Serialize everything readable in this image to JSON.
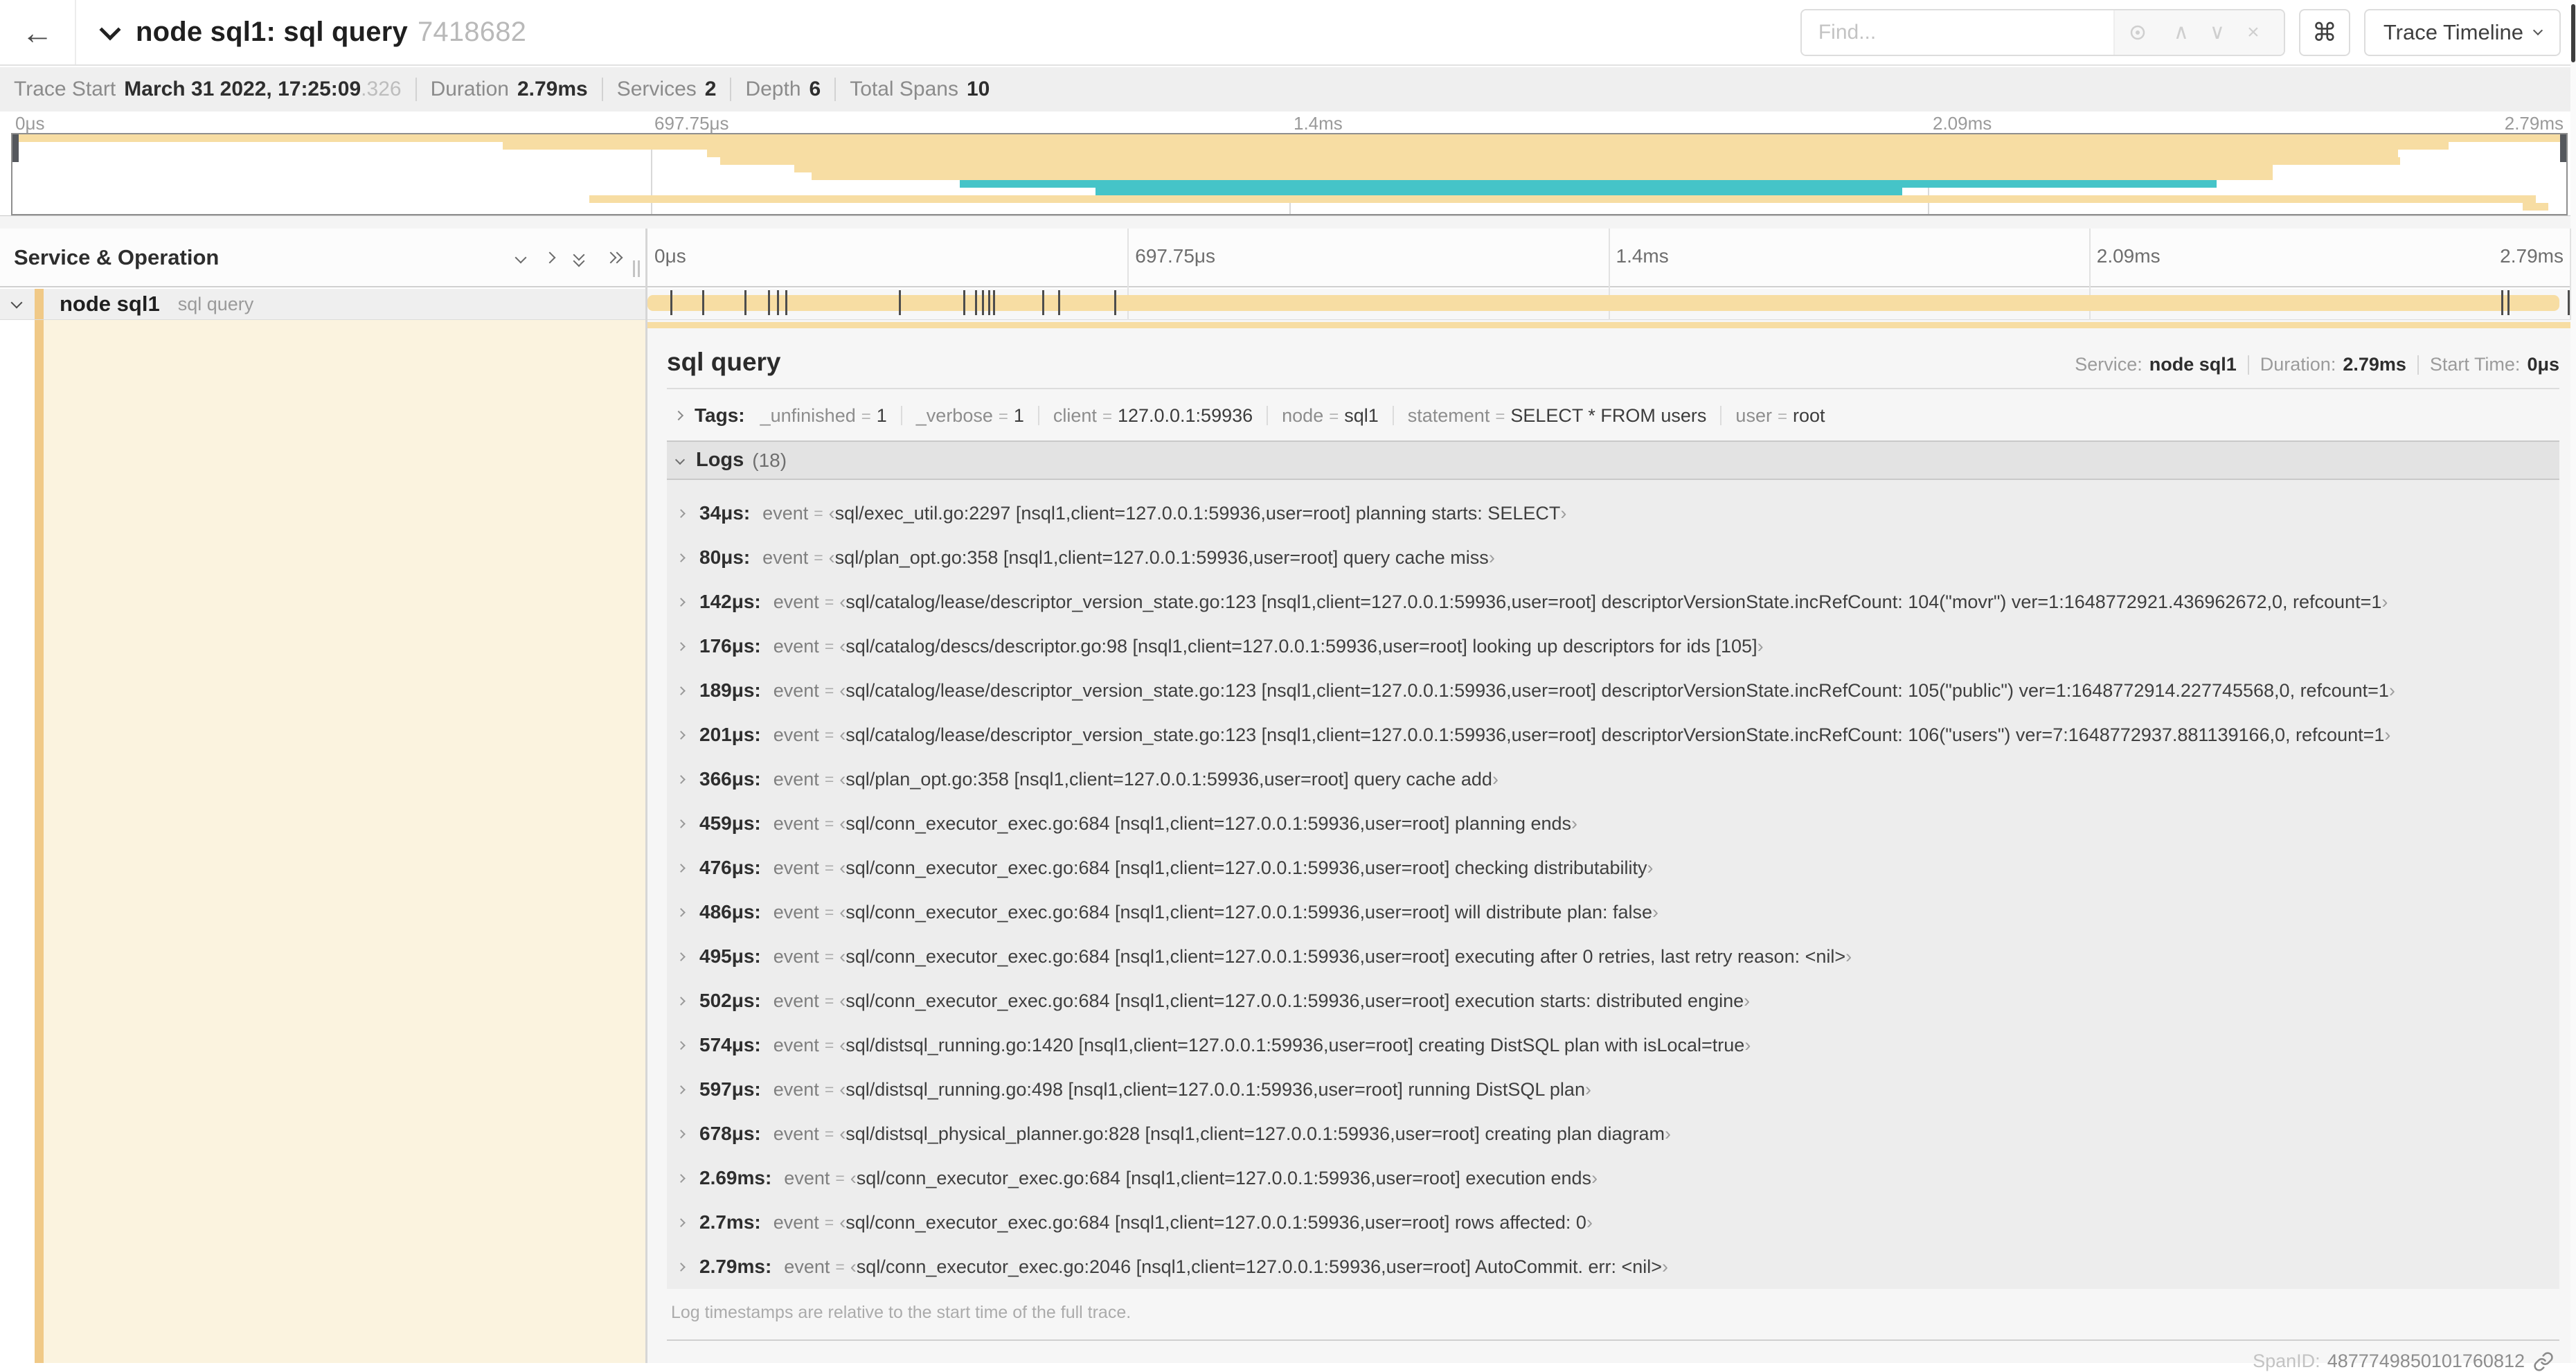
{
  "header": {
    "back_icon": "←",
    "title": "node sql1: sql query",
    "trace_id": "7418682",
    "find_placeholder": "Find...",
    "up_icon": "∧",
    "down_icon": "∨",
    "clear_icon": "×",
    "shortcut_icon": "⌘",
    "view_selector": "Trace Timeline"
  },
  "summary": {
    "items": [
      {
        "label": "Trace Start",
        "value": "March 31 2022, 17:25:09",
        "suffix": ".326"
      },
      {
        "label": "Duration",
        "value": "2.79ms",
        "suffix": ""
      },
      {
        "label": "Services",
        "value": "2",
        "suffix": ""
      },
      {
        "label": "Depth",
        "value": "6",
        "suffix": ""
      },
      {
        "label": "Total Spans",
        "value": "10",
        "suffix": ""
      }
    ]
  },
  "colors": {
    "tan": "#f7dda3",
    "teal": "#45c4c8",
    "accent": "#f0c987",
    "cream": "#fbf3df"
  },
  "chart_data": {
    "type": "gantt-minimap",
    "title": "trace span minimap",
    "x_ticks": [
      "0μs",
      "697.75μs",
      "1.4ms",
      "2.09ms",
      "2.79ms"
    ],
    "rows": [
      {
        "left": 0.0,
        "width": 100.0,
        "color": "tan"
      },
      {
        "left": 19.2,
        "width": 76.2,
        "color": "tan"
      },
      {
        "left": 27.2,
        "width": 66.2,
        "color": "tan"
      },
      {
        "left": 27.7,
        "width": 65.8,
        "color": "tan"
      },
      {
        "left": 30.6,
        "width": 57.9,
        "color": "tan"
      },
      {
        "left": 31.3,
        "width": 57.2,
        "color": "tan"
      },
      {
        "left": 37.1,
        "width": 49.2,
        "color": "teal"
      },
      {
        "left": 42.4,
        "width": 31.6,
        "color": "teal"
      },
      {
        "left": 22.6,
        "width": 76.2,
        "color": "tan"
      },
      {
        "left": 98.3,
        "width": 1.0,
        "color": "tan"
      }
    ]
  },
  "timeline": {
    "column_header": "Service & Operation",
    "ticks": [
      {
        "label": "0μs",
        "pct": 0,
        "align": "left"
      },
      {
        "label": "697.75μs",
        "pct": 25,
        "align": "left"
      },
      {
        "label": "1.4ms",
        "pct": 50,
        "align": "left"
      },
      {
        "label": "2.09ms",
        "pct": 75,
        "align": "left"
      },
      {
        "label": "2.79ms",
        "pct": 100,
        "align": "right"
      }
    ],
    "gridline_pcts": [
      25,
      50,
      75,
      100
    ]
  },
  "span_row": {
    "service": "node sql1",
    "operation": "sql query",
    "log_tick_pcts": [
      1.22,
      2.87,
      5.09,
      6.31,
      6.77,
      7.2,
      13.12,
      16.45,
      17.06,
      17.42,
      17.74,
      18.0,
      20.57,
      21.4,
      24.3,
      96.42,
      96.77,
      99.9
    ]
  },
  "detail": {
    "operation": "sql query",
    "meta": [
      {
        "label": "Service:",
        "value": "node sql1"
      },
      {
        "label": "Duration:",
        "value": "2.79ms"
      },
      {
        "label": "Start Time:",
        "value": "0μs"
      }
    ],
    "tags": {
      "label": "Tags:",
      "items": [
        {
          "key": "_unfinished",
          "value": "1"
        },
        {
          "key": "_verbose",
          "value": "1"
        },
        {
          "key": "client",
          "value": "127.0.0.1:59936"
        },
        {
          "key": "node",
          "value": "sql1"
        },
        {
          "key": "statement",
          "value": "SELECT * FROM users"
        },
        {
          "key": "user",
          "value": "root"
        }
      ]
    },
    "logs": {
      "label": "Logs",
      "count": "(18)",
      "quote_open": "‹",
      "quote_close": "›",
      "field": "event",
      "entries": [
        {
          "time": "34μs:",
          "value": "sql/exec_util.go:2297 [nsql1,client=127.0.0.1:59936,user=root] planning starts: SELECT"
        },
        {
          "time": "80μs:",
          "value": "sql/plan_opt.go:358 [nsql1,client=127.0.0.1:59936,user=root] query cache miss"
        },
        {
          "time": "142μs:",
          "value": "sql/catalog/lease/descriptor_version_state.go:123 [nsql1,client=127.0.0.1:59936,user=root] descriptorVersionState.incRefCount: 104(\"movr\") ver=1:1648772921.436962672,0, refcount=1"
        },
        {
          "time": "176μs:",
          "value": "sql/catalog/descs/descriptor.go:98 [nsql1,client=127.0.0.1:59936,user=root] looking up descriptors for ids [105]"
        },
        {
          "time": "189μs:",
          "value": "sql/catalog/lease/descriptor_version_state.go:123 [nsql1,client=127.0.0.1:59936,user=root] descriptorVersionState.incRefCount: 105(\"public\") ver=1:1648772914.227745568,0, refcount=1"
        },
        {
          "time": "201μs:",
          "value": "sql/catalog/lease/descriptor_version_state.go:123 [nsql1,client=127.0.0.1:59936,user=root] descriptorVersionState.incRefCount: 106(\"users\") ver=7:1648772937.881139166,0, refcount=1"
        },
        {
          "time": "366μs:",
          "value": "sql/plan_opt.go:358 [nsql1,client=127.0.0.1:59936,user=root] query cache add"
        },
        {
          "time": "459μs:",
          "value": "sql/conn_executor_exec.go:684 [nsql1,client=127.0.0.1:59936,user=root] planning ends"
        },
        {
          "time": "476μs:",
          "value": "sql/conn_executor_exec.go:684 [nsql1,client=127.0.0.1:59936,user=root] checking distributability"
        },
        {
          "time": "486μs:",
          "value": "sql/conn_executor_exec.go:684 [nsql1,client=127.0.0.1:59936,user=root] will distribute plan: false"
        },
        {
          "time": "495μs:",
          "value": "sql/conn_executor_exec.go:684 [nsql1,client=127.0.0.1:59936,user=root] executing after 0 retries, last retry reason: <nil>"
        },
        {
          "time": "502μs:",
          "value": "sql/conn_executor_exec.go:684 [nsql1,client=127.0.0.1:59936,user=root] execution starts: distributed engine"
        },
        {
          "time": "574μs:",
          "value": "sql/distsql_running.go:1420 [nsql1,client=127.0.0.1:59936,user=root] creating DistSQL plan with isLocal=true"
        },
        {
          "time": "597μs:",
          "value": "sql/distsql_running.go:498 [nsql1,client=127.0.0.1:59936,user=root] running DistSQL plan"
        },
        {
          "time": "678μs:",
          "value": "sql/distsql_physical_planner.go:828 [nsql1,client=127.0.0.1:59936,user=root] creating plan diagram"
        },
        {
          "time": "2.69ms:",
          "value": "sql/conn_executor_exec.go:684 [nsql1,client=127.0.0.1:59936,user=root] execution ends"
        },
        {
          "time": "2.7ms:",
          "value": "sql/conn_executor_exec.go:684 [nsql1,client=127.0.0.1:59936,user=root] rows affected: 0"
        },
        {
          "time": "2.79ms:",
          "value": "sql/conn_executor_exec.go:2046 [nsql1,client=127.0.0.1:59936,user=root] AutoCommit. err: <nil>"
        }
      ],
      "footnote": "Log timestamps are relative to the start time of the full trace."
    },
    "span_id_label": "SpanID:",
    "span_id": "4877749850101760812"
  }
}
